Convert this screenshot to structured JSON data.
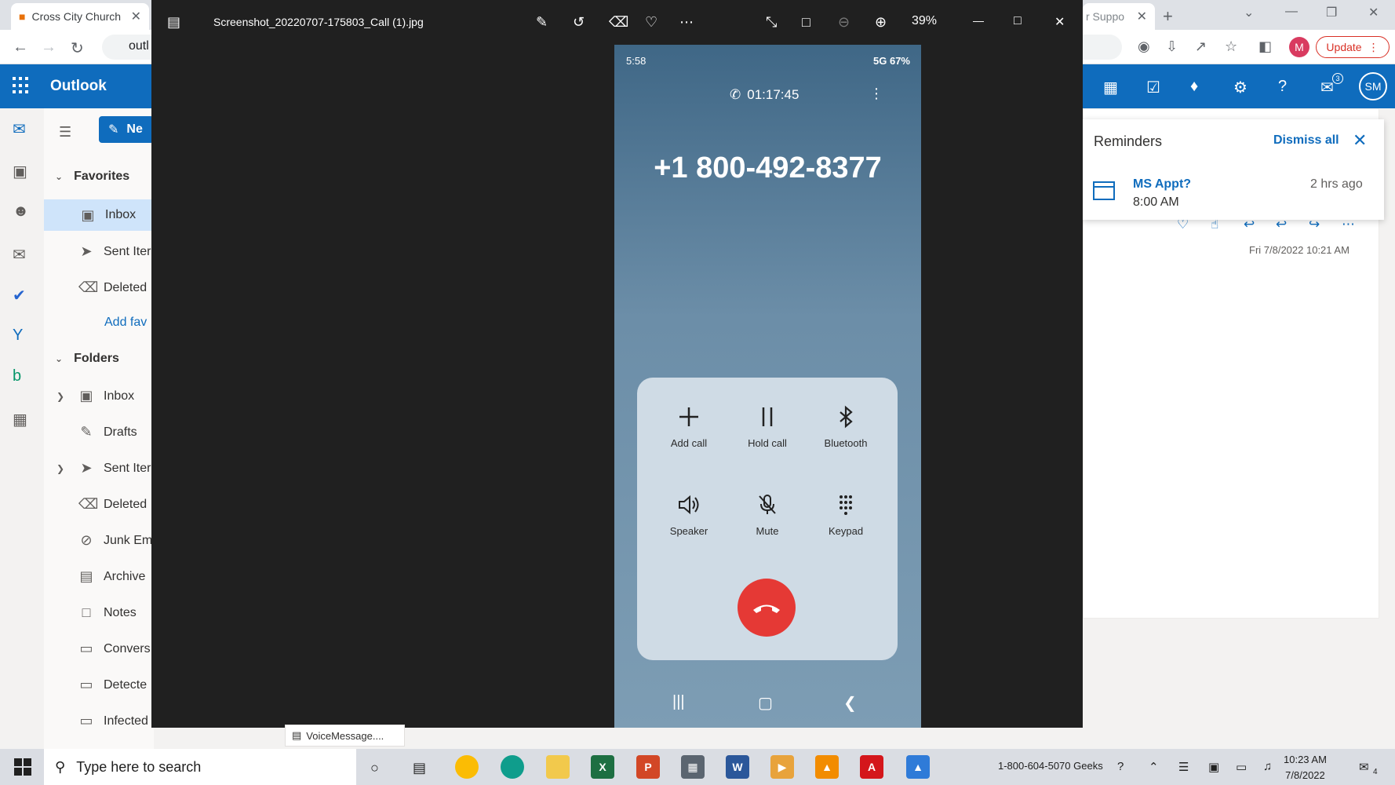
{
  "browser": {
    "tab_left_title": "Cross City Church",
    "tab_right_title": "r Suppo",
    "address_text": "outl",
    "update_label": "Update",
    "profile_initial": "M"
  },
  "outlook": {
    "app_title": "Outlook",
    "new_label": "Ne",
    "user_initials": "SM",
    "notification_count": "3",
    "favorites_label": "Favorites",
    "folders_label": "Folders",
    "favorites": [
      "Inbox",
      "Sent Iter",
      "Deleted"
    ],
    "add_favorite": "Add fav",
    "folders": [
      "Inbox",
      "Drafts",
      "Sent Iter",
      "Deleted",
      "Junk Em",
      "Archive",
      "Notes",
      "Convers",
      "Detecte",
      "Infected"
    ],
    "message_date": "Fri 7/8/2022 10:21 AM"
  },
  "reminders": {
    "title": "Reminders",
    "dismiss_all": "Dismiss all",
    "subject": "MS Appt?",
    "time": "8:00 AM",
    "ago": "2 hrs ago"
  },
  "viewer": {
    "filename": "Screenshot_20220707-175803_Call (1).jpg",
    "zoom": "39%"
  },
  "phone": {
    "status_time": "5:58",
    "status_right": "5G  67%",
    "call_timer": "01:17:45",
    "number": "+1 800-492-8377",
    "controls": [
      "Add call",
      "Hold call",
      "Bluetooth",
      "Speaker",
      "Mute",
      "Keypad"
    ],
    "end_call_color": "#e53935"
  },
  "attachment": {
    "name": "VoiceMessage...."
  },
  "taskbar": {
    "search_placeholder": "Type here to search",
    "phone_label": "1-800-604-5070 Geeks",
    "time": "10:23 AM",
    "date": "7/8/2022",
    "notification_count": "4"
  },
  "colors": {
    "outlook_blue": "#0f6cbd",
    "viewer_bg": "#202020",
    "selected_folder": "#cfe4fa"
  }
}
